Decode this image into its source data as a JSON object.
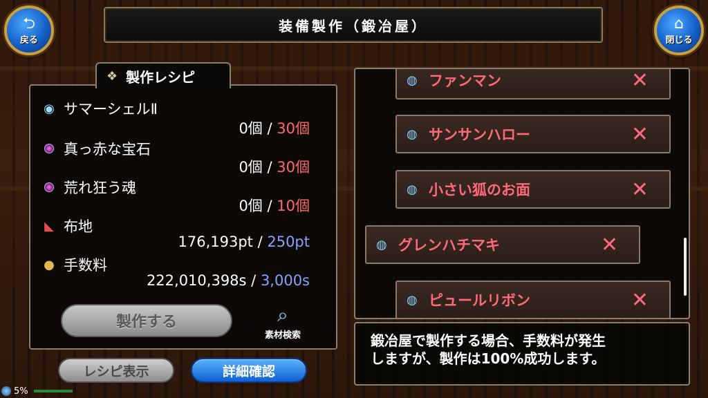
{
  "header": {
    "title": "装備製作（鍛冶屋）",
    "back_label": "戻る",
    "close_label": "閉じる",
    "back_icon": "back-arrow-icon",
    "close_icon": "home-icon"
  },
  "recipe": {
    "tab_title": "製作レシピ",
    "materials": [
      {
        "name": "サマーシェルⅡ",
        "have": "0個",
        "sep": "/",
        "need": "30個",
        "icon": "shell-icon"
      },
      {
        "name": "真っ赤な宝石",
        "have": "0個",
        "sep": "/",
        "need": "30個",
        "icon": "gem-icon"
      },
      {
        "name": "荒れ狂う魂",
        "have": "0個",
        "sep": "/",
        "need": "10個",
        "icon": "gem-icon"
      },
      {
        "name": "布地",
        "have": "176,193pt",
        "sep": "/",
        "need": "250pt",
        "icon": "cloth-icon"
      },
      {
        "name": "手数料",
        "have": "222,010,398s",
        "sep": "/",
        "need": "3,000s",
        "icon": "coin-icon"
      }
    ],
    "craft_label": "製作する",
    "search_label": "素材検索"
  },
  "bottom_buttons": {
    "recipe_show": "レシピ表示",
    "detail_confirm": "詳細確認"
  },
  "list": {
    "items": [
      {
        "name": "ファンマン"
      },
      {
        "name": "サンサンハロー"
      },
      {
        "name": "小さい狐のお面"
      },
      {
        "name": "グレンハチマキ"
      },
      {
        "name": "ピュールリボン"
      }
    ],
    "remove_symbol": "✕"
  },
  "info": {
    "line1": "鍛冶屋で製作する場合、手数料が発生",
    "line2": "しますが、製作は100%成功します。"
  },
  "status": {
    "percent": "5%"
  },
  "colors": {
    "accent_red": "#ff6a7a",
    "accent_blue": "#8aa0ff",
    "button_blue": "#1060d0"
  }
}
